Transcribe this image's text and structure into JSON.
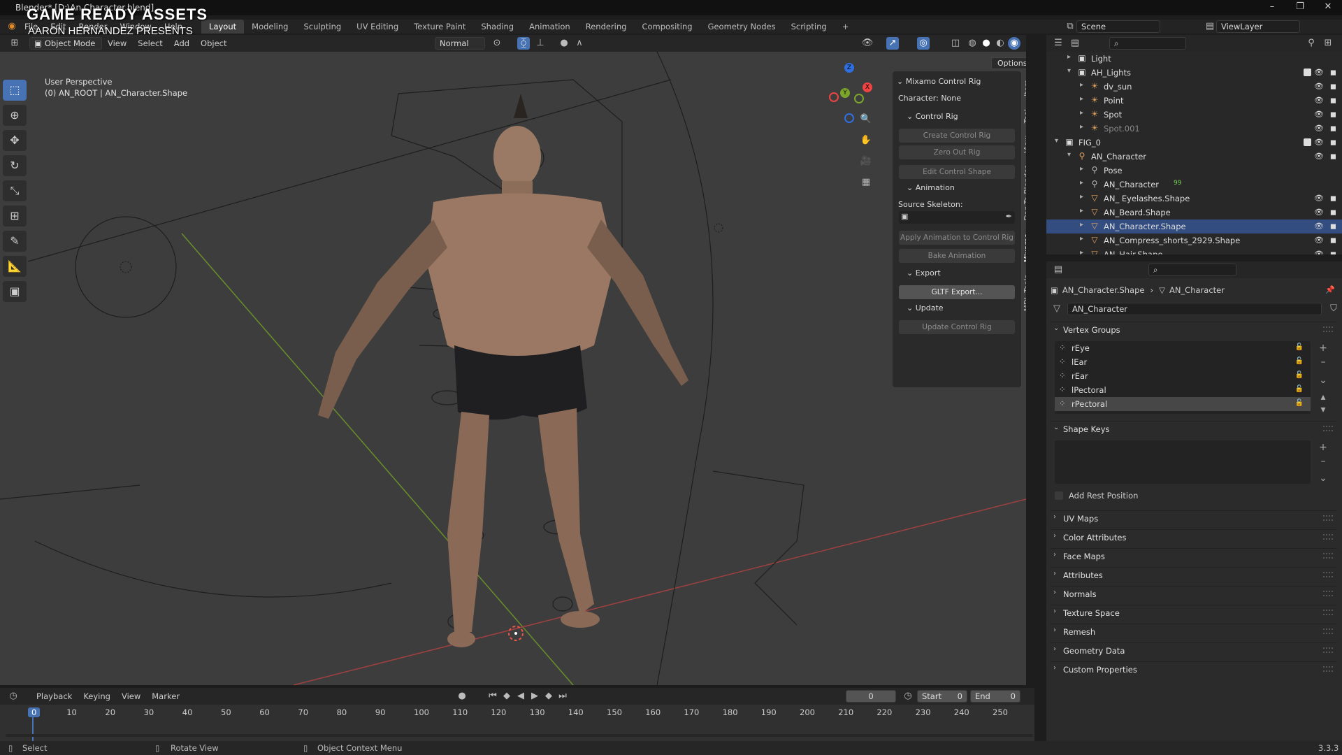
{
  "window": {
    "title": "Blender* [D:\\An Character.blend]",
    "brand_title": "GAME READY ASSETS",
    "brand_sub": "AARON HERNANDEZ PRESENTS"
  },
  "menu": {
    "items": [
      "File",
      "Edit",
      "Render",
      "Window",
      "Help"
    ]
  },
  "workspaces": [
    "Layout",
    "Modeling",
    "Sculpting",
    "UV Editing",
    "Texture Paint",
    "Shading",
    "Animation",
    "Rendering",
    "Compositing",
    "Geometry Nodes",
    "Scripting",
    "+"
  ],
  "scene": {
    "label": "Scene",
    "viewlayer": "ViewLayer"
  },
  "viewport_header": {
    "mode": "Object Mode",
    "menus": [
      "View",
      "Select",
      "Add",
      "Object"
    ],
    "orientation": "Normal",
    "options": "Options"
  },
  "viewport": {
    "perspective": "User Perspective",
    "object_info": "(0) AN_ROOT | AN_Character.Shape",
    "gizmo_axes": [
      "Z",
      "Y",
      "X"
    ]
  },
  "npanel": {
    "title": "Mixamo Control Rig",
    "character": "Character: None",
    "control_rig": "Control Rig",
    "create_control_rig": "Create Control Rig",
    "zero_out_rig": "Zero Out Rig",
    "edit_control_shape": "Edit Control Shape",
    "animation": "Animation",
    "source_skeleton": "Source Skeleton:",
    "apply_animation": "Apply Animation to Control Rig",
    "bake_animation": "Bake Animation",
    "export": "Export",
    "gltf_export": "GLTF Export...",
    "update": "Update",
    "update_control_rig": "Update Control Rig",
    "tabs": [
      "Item",
      "Tool",
      "View",
      "Daz To Blender",
      "Mixamo",
      "MDL Tools"
    ]
  },
  "outliner": {
    "rows": [
      {
        "label": "Light",
        "indent": 2,
        "icon": "collection-icon"
      },
      {
        "label": "AH_Lights",
        "indent": 2,
        "icon": "collection-icon"
      },
      {
        "label": "dv_sun",
        "indent": 3,
        "icon": "light-icon"
      },
      {
        "label": "Point",
        "indent": 3,
        "icon": "light-icon"
      },
      {
        "label": "Spot",
        "indent": 3,
        "icon": "light-icon"
      },
      {
        "label": "Spot.001",
        "indent": 3,
        "icon": "light-icon"
      },
      {
        "label": "FIG_0",
        "indent": 1,
        "icon": "collection-icon"
      },
      {
        "label": "AN_Character",
        "indent": 2,
        "icon": "armature-icon"
      },
      {
        "label": "Pose",
        "indent": 3,
        "icon": "pose-icon"
      },
      {
        "label": "AN_Character",
        "indent": 3,
        "icon": "armature-data-icon",
        "badge": "99"
      },
      {
        "label": "AN_ Eyelashes.Shape",
        "indent": 3,
        "icon": "mesh-icon"
      },
      {
        "label": "AN_Beard.Shape",
        "indent": 3,
        "icon": "mesh-icon"
      },
      {
        "label": "AN_Character.Shape",
        "indent": 3,
        "icon": "mesh-icon",
        "selected": true
      },
      {
        "label": "AN_Compress_shorts_2929.Shape",
        "indent": 3,
        "icon": "mesh-icon"
      },
      {
        "label": "AN_Hair.Shape",
        "indent": 3,
        "icon": "mesh-icon"
      }
    ]
  },
  "properties": {
    "breadcrumb": [
      "AN_Character.Shape",
      "AN_Character"
    ],
    "mesh_name": "AN_Character",
    "vertex_groups_label": "Vertex Groups",
    "vertex_groups": [
      "rEye",
      "lEar",
      "rEar",
      "lPectoral",
      "rPectoral"
    ],
    "shape_keys_label": "Shape Keys",
    "add_rest_position": "Add Rest Position",
    "sections": [
      "UV Maps",
      "Color Attributes",
      "Face Maps",
      "Attributes",
      "Normals",
      "Texture Space",
      "Remesh",
      "Geometry Data",
      "Custom Properties"
    ]
  },
  "timeline": {
    "menus": [
      "Playback",
      "Keying",
      "View",
      "Marker"
    ],
    "current_frame": "0",
    "start_label": "Start",
    "start": "0",
    "end_label": "End",
    "end": "0",
    "ticks": [
      "0",
      "10",
      "20",
      "30",
      "40",
      "50",
      "60",
      "70",
      "80",
      "90",
      "100",
      "110",
      "120",
      "130",
      "140",
      "150",
      "160",
      "170",
      "180",
      "190",
      "200",
      "210",
      "220",
      "230",
      "240",
      "250"
    ]
  },
  "statusbar": {
    "select": "Select",
    "rotate": "Rotate View",
    "context": "Object Context Menu",
    "version": "3.3.3"
  },
  "colors": {
    "accent": "#4772b3",
    "selected_row": "#334d80",
    "viewport_bg": "#3d3d3d"
  }
}
